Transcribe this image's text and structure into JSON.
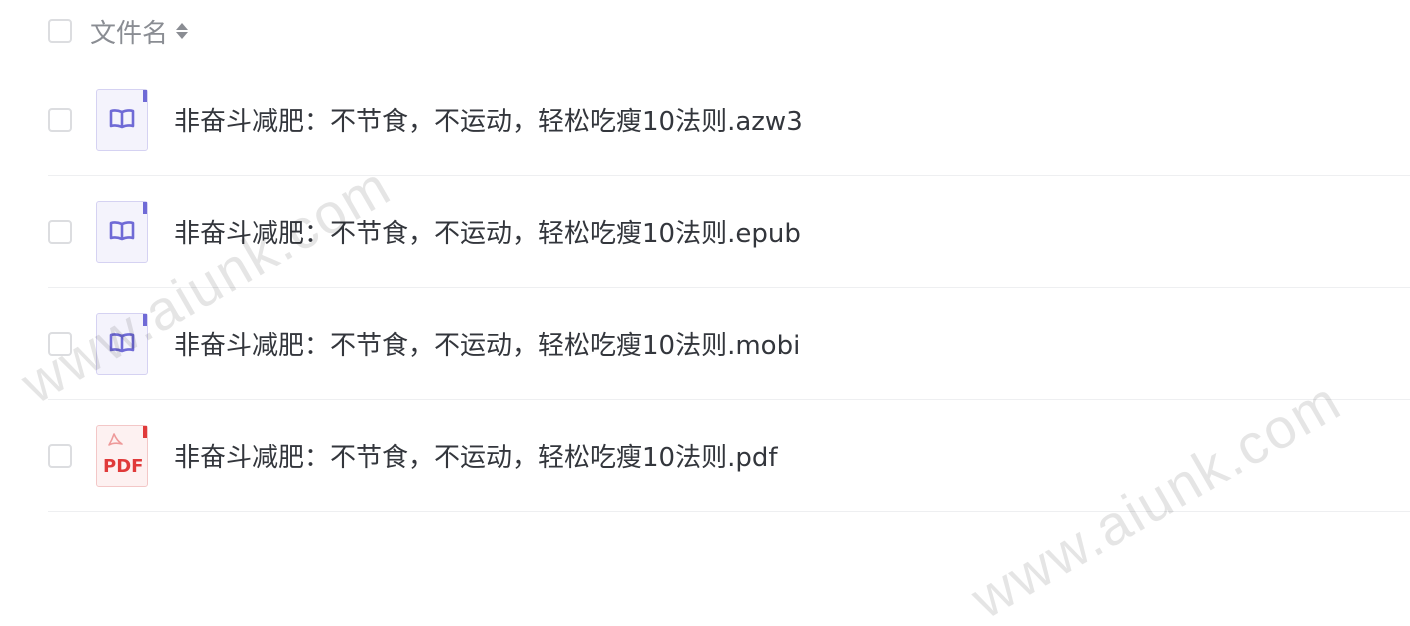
{
  "header": {
    "column_label": "文件名",
    "sort_icon": "sort-icon"
  },
  "files": [
    {
      "name": "非奋斗减肥：不节食，不运动，轻松吃瘦10法则.azw3",
      "icon": "ebook-icon"
    },
    {
      "name": "非奋斗减肥：不节食，不运动，轻松吃瘦10法则.epub",
      "icon": "ebook-icon"
    },
    {
      "name": "非奋斗减肥：不节食，不运动，轻松吃瘦10法则.mobi",
      "icon": "ebook-icon"
    },
    {
      "name": "非奋斗减肥：不节食，不运动，轻松吃瘦10法则.pdf",
      "icon": "pdf-icon",
      "icon_label": "PDF"
    }
  ],
  "watermark": {
    "text": "www.aiunk.com"
  },
  "colors": {
    "ebook_accent": "#6f6ad6",
    "pdf_accent": "#e03a3a",
    "divider": "#eeeff1"
  }
}
